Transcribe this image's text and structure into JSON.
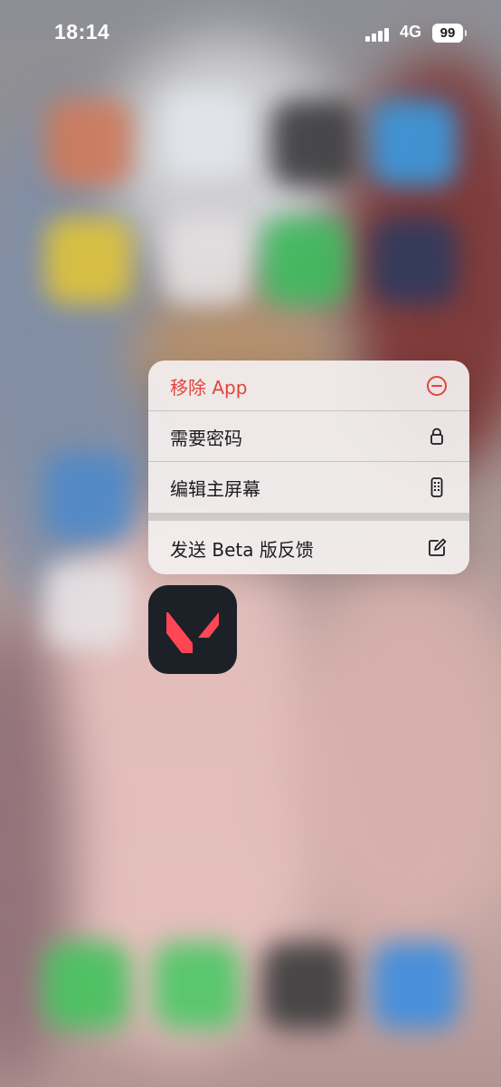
{
  "status_bar": {
    "time": "18:14",
    "network": "4G",
    "battery": "99"
  },
  "context_menu": {
    "items": [
      {
        "label": "移除 App",
        "icon": "minus-circle-icon",
        "destructive": true
      },
      {
        "label": "需要密码",
        "icon": "lock-icon",
        "destructive": false
      },
      {
        "label": "编辑主屏幕",
        "icon": "phone-apps-icon",
        "destructive": false
      },
      {
        "label": "发送 Beta 版反馈",
        "icon": "compose-icon",
        "destructive": false
      }
    ]
  },
  "app": {
    "icon": "valorant-logo-icon"
  },
  "colors": {
    "destructive": "#e5433d",
    "text": "#1c1c1e",
    "app_icon_bg": "#1c2128",
    "logo_red": "#ff4655"
  }
}
